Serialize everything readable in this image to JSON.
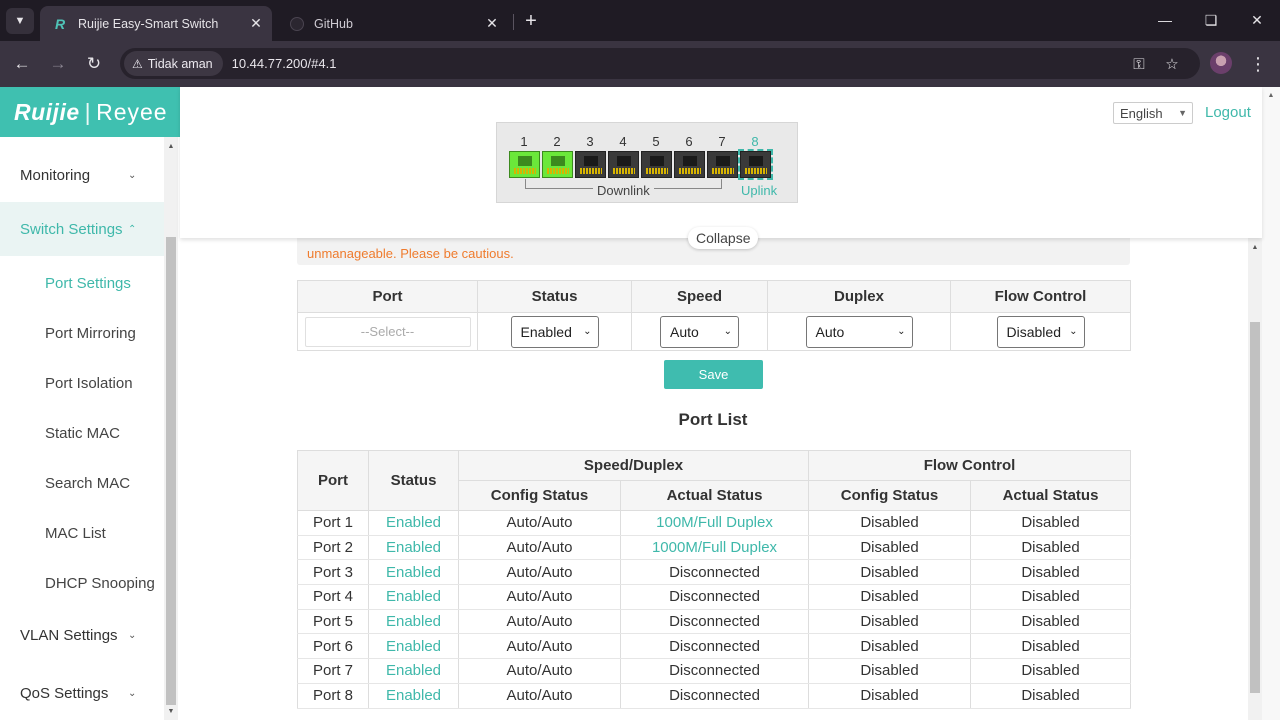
{
  "browser": {
    "tabs": [
      {
        "title": "Ruijie Easy-Smart Switch",
        "favicon": "R"
      },
      {
        "title": "GitHub"
      }
    ],
    "security_label": "Tidak aman",
    "url": "10.44.77.200/#4.1"
  },
  "sidebar": {
    "logo_left": "Ruijie",
    "logo_sep": "|",
    "logo_right": "Reyee",
    "items": [
      {
        "label": "Monitoring"
      },
      {
        "label": "Switch Settings"
      },
      {
        "label": "Port Settings"
      },
      {
        "label": "Port Mirroring"
      },
      {
        "label": "Port Isolation"
      },
      {
        "label": "Static MAC"
      },
      {
        "label": "Search MAC"
      },
      {
        "label": "MAC List"
      },
      {
        "label": "DHCP Snooping"
      },
      {
        "label": "VLAN Settings"
      },
      {
        "label": "QoS Settings"
      }
    ]
  },
  "header": {
    "language": "English",
    "logout": "Logout",
    "ports": [
      "1",
      "2",
      "3",
      "4",
      "5",
      "6",
      "7",
      "8"
    ],
    "port_states": [
      "up",
      "up",
      "down",
      "down",
      "down",
      "down",
      "down",
      "down"
    ],
    "downlink_label": "Downlink",
    "uplink_label": "Uplink",
    "collapse": "Collapse"
  },
  "warning": {
    "text": "unmanageable. Please be cautious."
  },
  "config": {
    "headers": [
      "Port",
      "Status",
      "Speed",
      "Duplex",
      "Flow Control"
    ],
    "port_placeholder": "--Select--",
    "status": "Enabled",
    "speed": "Auto",
    "duplex": "Auto",
    "flow_control": "Disabled",
    "save": "Save"
  },
  "port_list": {
    "title": "Port List",
    "headers": {
      "port": "Port",
      "status": "Status",
      "speed_duplex": "Speed/Duplex",
      "flow_control": "Flow Control",
      "config_status": "Config Status",
      "actual_status": "Actual Status"
    },
    "rows": [
      {
        "port": "Port 1",
        "status": "Enabled",
        "sd_config": "Auto/Auto",
        "sd_actual": "100M/Full Duplex",
        "fc_config": "Disabled",
        "fc_actual": "Disabled"
      },
      {
        "port": "Port 2",
        "status": "Enabled",
        "sd_config": "Auto/Auto",
        "sd_actual": "1000M/Full Duplex",
        "fc_config": "Disabled",
        "fc_actual": "Disabled"
      },
      {
        "port": "Port 3",
        "status": "Enabled",
        "sd_config": "Auto/Auto",
        "sd_actual": "Disconnected",
        "fc_config": "Disabled",
        "fc_actual": "Disabled"
      },
      {
        "port": "Port 4",
        "status": "Enabled",
        "sd_config": "Auto/Auto",
        "sd_actual": "Disconnected",
        "fc_config": "Disabled",
        "fc_actual": "Disabled"
      },
      {
        "port": "Port 5",
        "status": "Enabled",
        "sd_config": "Auto/Auto",
        "sd_actual": "Disconnected",
        "fc_config": "Disabled",
        "fc_actual": "Disabled"
      },
      {
        "port": "Port 6",
        "status": "Enabled",
        "sd_config": "Auto/Auto",
        "sd_actual": "Disconnected",
        "fc_config": "Disabled",
        "fc_actual": "Disabled"
      },
      {
        "port": "Port 7",
        "status": "Enabled",
        "sd_config": "Auto/Auto",
        "sd_actual": "Disconnected",
        "fc_config": "Disabled",
        "fc_actual": "Disabled"
      },
      {
        "port": "Port 8",
        "status": "Enabled",
        "sd_config": "Auto/Auto",
        "sd_actual": "Disconnected",
        "fc_config": "Disabled",
        "fc_actual": "Disabled"
      }
    ]
  },
  "colors": {
    "accent": "#3fb8aa",
    "link_up": "#6be83a",
    "warning": "#ef7b2d"
  }
}
